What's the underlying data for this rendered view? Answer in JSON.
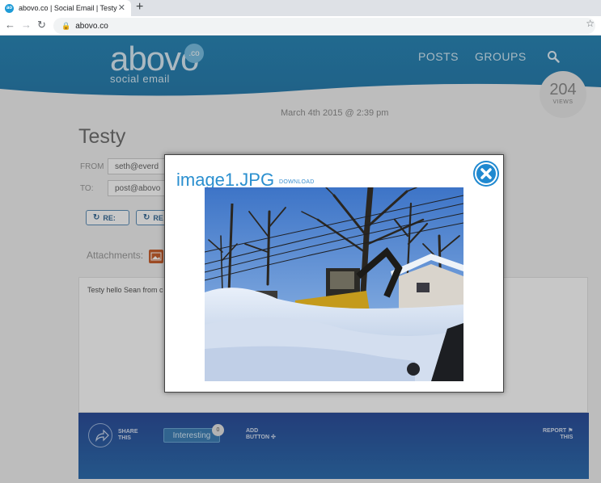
{
  "browser": {
    "tab_title": "abovo.co | Social Email | Testy",
    "favicon_text": "ao",
    "tab_close": "✕",
    "new_tab": "+",
    "back": "←",
    "forward": "→",
    "reload": "↻",
    "lock": "🔒",
    "url": "abovo.co",
    "bookmark": "☆"
  },
  "header": {
    "logo_word": "abovo",
    "logo_co": ".co",
    "logo_sub": "social email",
    "nav": [
      "POSTS",
      "GROUPS"
    ],
    "views_count": "204",
    "views_label": "VIEWS"
  },
  "post": {
    "date": "March 4th 2015 @ 2:39 pm",
    "title": "Testy",
    "from_label": "FROM",
    "from_value": "seth@everd",
    "to_label": "TO:",
    "to_value": "post@abovo",
    "re_buttons": [
      "RE:",
      "RE"
    ],
    "attachments_label": "Attachments:",
    "body_text": "Testy hello Sean from c"
  },
  "footer": {
    "share_line1": "SHARE",
    "share_line2": "THIS",
    "interesting_label": "Interesting",
    "interesting_count": "0",
    "add_line1": "ADD",
    "add_line2": "BUTTON",
    "add_icon": "✣",
    "report_line1": "REPORT",
    "report_line2": "THIS",
    "report_icon": "⚑"
  },
  "modal": {
    "title": "image1.JPG",
    "download_label": "DOWNLOAD"
  },
  "colors": {
    "brand_blue": "#2b88b8",
    "modal_accent": "#2089d0",
    "footer_blue": "#2d4f9c"
  }
}
